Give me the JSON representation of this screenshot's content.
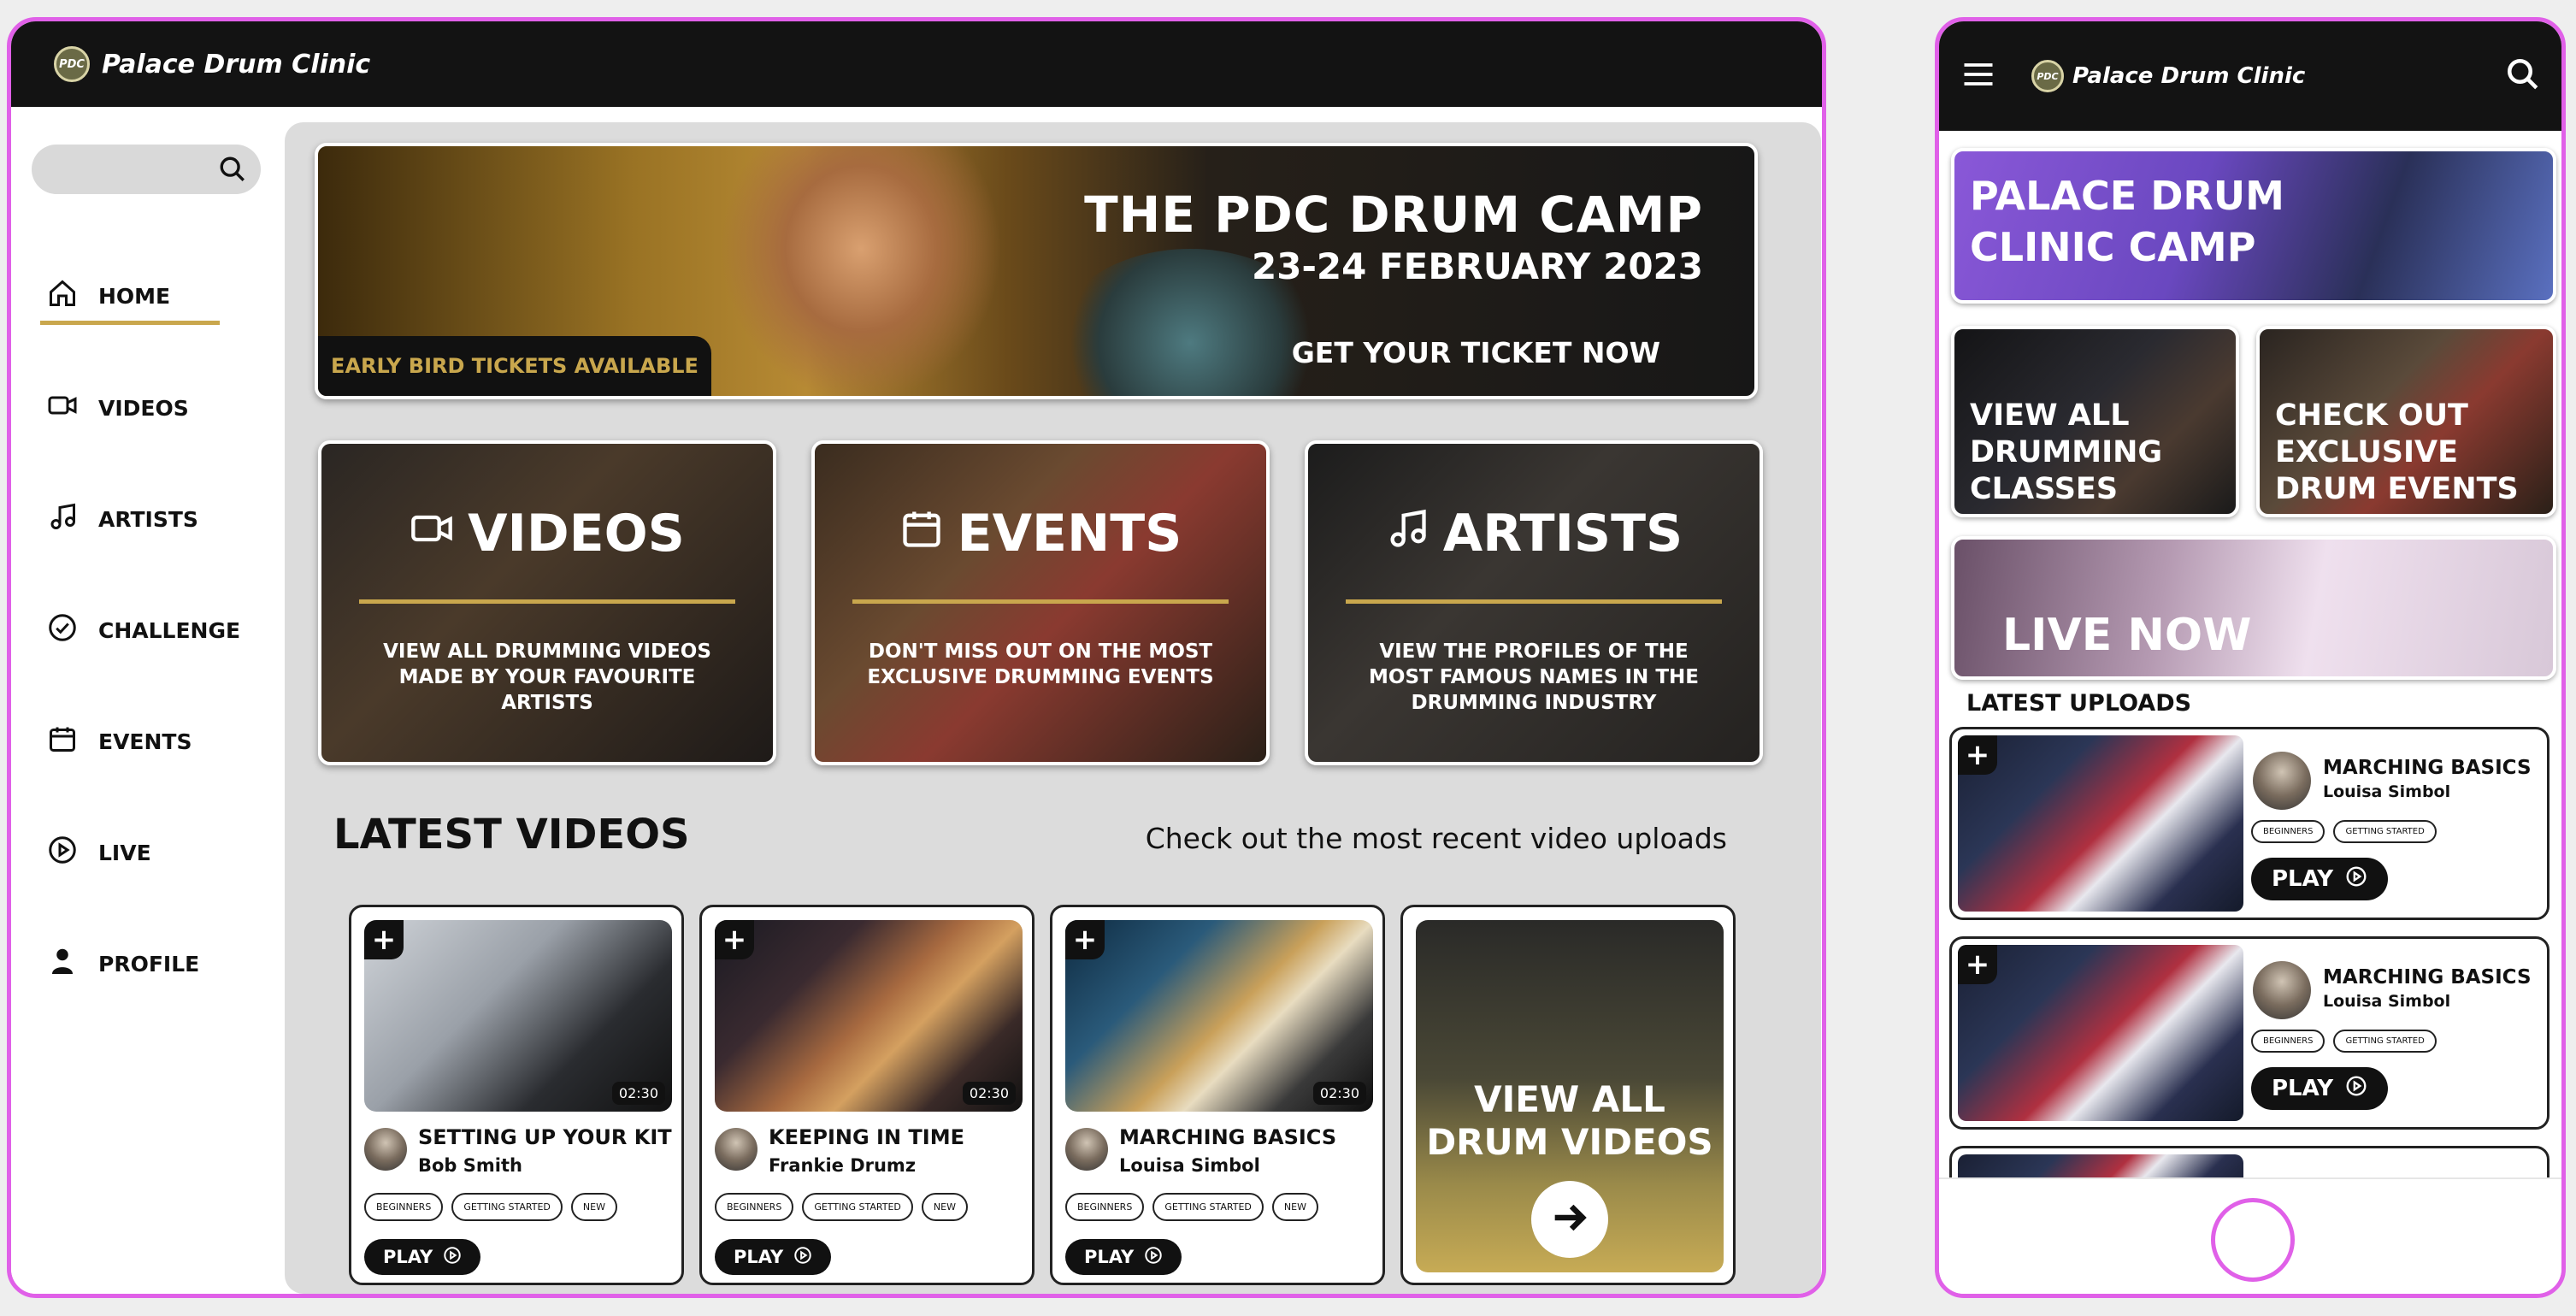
{
  "brand": {
    "name": "Palace Drum Clinic",
    "logo_text": "PDC"
  },
  "colors": {
    "accent": "#c9a74d",
    "bar": "#131313",
    "frame": "#e060e8",
    "content_bg": "#dcdcdc"
  },
  "desktop": {
    "search": {
      "placeholder": "",
      "icon": "search-icon"
    },
    "nav": [
      {
        "label": "HOME",
        "icon": "home-icon",
        "active": true
      },
      {
        "label": "VIDEOS",
        "icon": "video-camera-icon"
      },
      {
        "label": "ARTISTS",
        "icon": "music-note-icon"
      },
      {
        "label": "CHALLENGE",
        "icon": "check-circle-icon"
      },
      {
        "label": "EVENTS",
        "icon": "calendar-icon"
      },
      {
        "label": "LIVE",
        "icon": "play-circle-icon"
      },
      {
        "label": "PROFILE",
        "icon": "person-icon"
      }
    ],
    "hero": {
      "title": "THE PDC DRUM CAMP",
      "date": "23-24 FEBRUARY 2023",
      "cta": "GET YOUR TICKET NOW",
      "tag": "EARLY BIRD TICKETS AVAILABLE"
    },
    "categories": [
      {
        "title": "VIDEOS",
        "text": "VIEW ALL DRUMMING VIDEOS MADE BY YOUR FAVOURITE ARTISTS"
      },
      {
        "title": "EVENTS",
        "text": "DON'T MISS OUT ON THE MOST EXCLUSIVE DRUMMING EVENTS"
      },
      {
        "title": "ARTISTS",
        "text": "VIEW THE PROFILES OF THE MOST FAMOUS NAMES IN THE DRUMMING INDUSTRY"
      }
    ],
    "latest": {
      "title": "LATEST VIDEOS",
      "subtitle": "Check out the most recent video uploads"
    },
    "videos": [
      {
        "title": "SETTING UP YOUR KIT",
        "artist": "Bob Smith",
        "duration": "02:30",
        "tags": [
          "BEGINNERS",
          "GETTING STARTED",
          "NEW"
        ],
        "play": "PLAY"
      },
      {
        "title": "KEEPING IN TIME",
        "artist": "Frankie Drumz",
        "duration": "02:30",
        "tags": [
          "BEGINNERS",
          "GETTING STARTED",
          "NEW"
        ],
        "play": "PLAY"
      },
      {
        "title": "MARCHING BASICS",
        "artist": "Louisa Simbol",
        "duration": "02:30",
        "tags": [
          "BEGINNERS",
          "GETTING STARTED",
          "NEW"
        ],
        "play": "PLAY"
      }
    ],
    "view_all": {
      "line1": "VIEW ALL",
      "line2": "DRUM VIDEOS"
    }
  },
  "mobile": {
    "hero": {
      "line1": "PALACE DRUM",
      "line2": "CLINIC CAMP"
    },
    "tiles": [
      {
        "lines": [
          "VIEW ALL",
          "DRUMMING",
          "CLASSES"
        ]
      },
      {
        "lines": [
          "CHECK OUT",
          "EXCLUSIVE",
          "DRUM EVENTS"
        ]
      }
    ],
    "live": "LIVE NOW",
    "latest_title": "LATEST UPLOADS",
    "uploads": [
      {
        "title": "MARCHING BASICS",
        "artist": "Louisa Simbol",
        "tags": [
          "BEGINNERS",
          "GETTING STARTED"
        ],
        "play": "PLAY"
      },
      {
        "title": "MARCHING BASICS",
        "artist": "Louisa Simbol",
        "tags": [
          "BEGINNERS",
          "GETTING STARTED"
        ],
        "play": "PLAY"
      }
    ]
  }
}
